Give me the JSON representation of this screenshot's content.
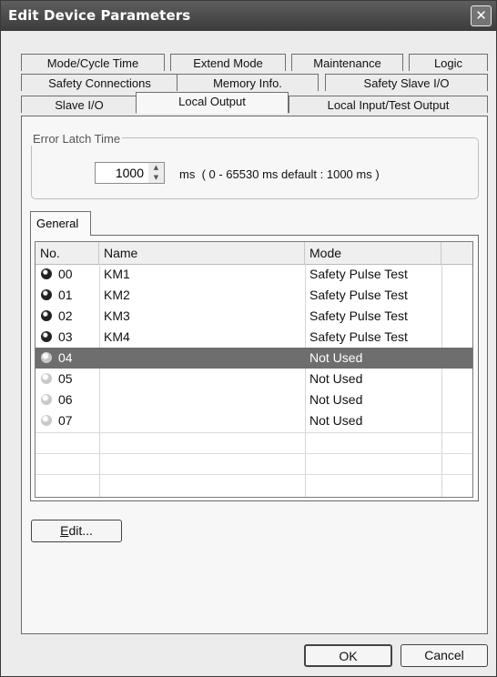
{
  "dialog": {
    "title": "Edit Device Parameters",
    "close_glyph": "✕"
  },
  "tab_rows": [
    [
      "Mode/Cycle Time",
      "Extend Mode",
      "Maintenance",
      "Logic"
    ],
    [
      "Safety Connections",
      "Memory Info.",
      "Safety Slave I/O"
    ],
    [
      "Slave I/O",
      "Local Output",
      "Local Input/Test Output"
    ]
  ],
  "active_tab": "Local Output",
  "error_latch": {
    "legend": "Error Latch Time",
    "value": "1000",
    "unit": "ms",
    "range": "( 0 - 65530 ms   default : 1000 ms )"
  },
  "sub_tabs": [
    "General"
  ],
  "table": {
    "columns": [
      "No.",
      "Name",
      "Mode"
    ],
    "rows": [
      {
        "no": "00",
        "name": "KM1",
        "mode": "Safety Pulse Test",
        "led": "on"
      },
      {
        "no": "01",
        "name": "KM2",
        "mode": "Safety Pulse Test",
        "led": "on"
      },
      {
        "no": "02",
        "name": "KM3",
        "mode": "Safety Pulse Test",
        "led": "on"
      },
      {
        "no": "03",
        "name": "KM4",
        "mode": "Safety Pulse Test",
        "led": "on"
      },
      {
        "no": "04",
        "name": "",
        "mode": "Not Used",
        "led": "off",
        "selected": true
      },
      {
        "no": "05",
        "name": "",
        "mode": "Not Used",
        "led": "off"
      },
      {
        "no": "06",
        "name": "",
        "mode": "Not Used",
        "led": "off"
      },
      {
        "no": "07",
        "name": "",
        "mode": "Not Used",
        "led": "off"
      }
    ]
  },
  "buttons": {
    "edit_mnemonic": "E",
    "edit_rest": "dit...",
    "ok": "OK",
    "cancel": "Cancel"
  }
}
